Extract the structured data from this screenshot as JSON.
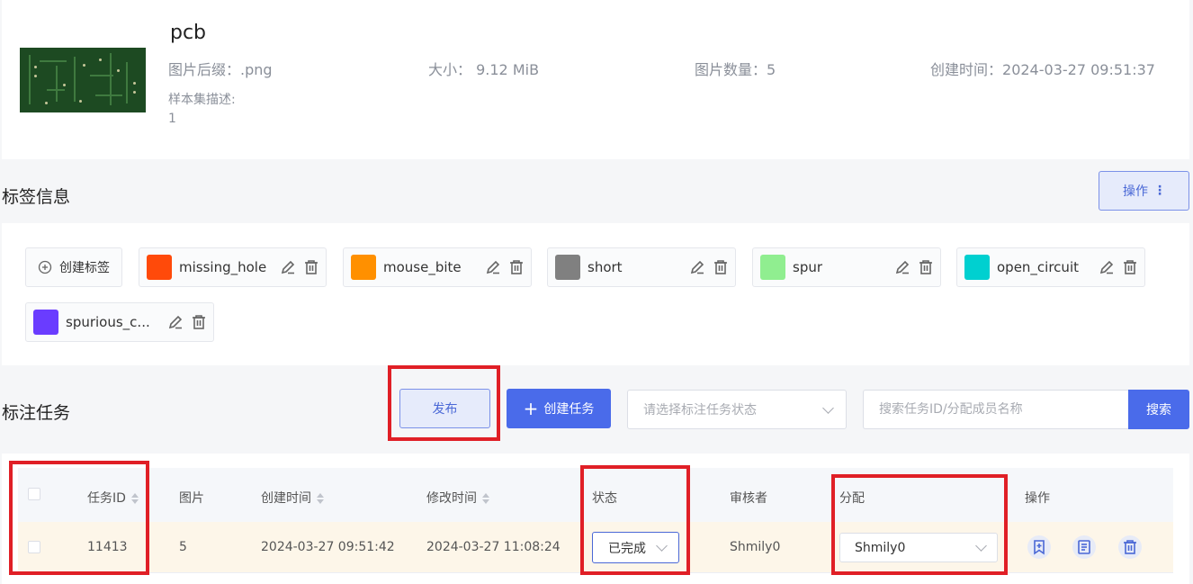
{
  "dataset": {
    "name": "pcb",
    "suffix_label": "图片后缀：",
    "suffix_value": ".png",
    "size_label": "大小：",
    "size_value": "9.12 MiB",
    "count_label": "图片数量：",
    "count_value": "5",
    "created_label": "创建时间：",
    "created_value": "2024-03-27 09:51:37",
    "desc_label": "样本集描述:",
    "desc_value": "1"
  },
  "labels_section": {
    "title": "标签信息",
    "ops_label": "操作",
    "create_label": "创建标签",
    "labels": [
      {
        "name": "missing_hole",
        "color": "#ff4a0a"
      },
      {
        "name": "mouse_bite",
        "color": "#ff9000"
      },
      {
        "name": "short",
        "color": "#808080"
      },
      {
        "name": "spur",
        "color": "#90ee90"
      },
      {
        "name": "open_circuit",
        "color": "#00d0d0"
      },
      {
        "name": "spurious_c...",
        "color": "#6a3cff"
      }
    ]
  },
  "tasks_section": {
    "title": "标注任务",
    "publish_label": "发布",
    "create_task_label": "创建任务",
    "status_placeholder": "请选择标注任务状态",
    "search_placeholder": "搜索任务ID/分配成员名称",
    "search_label": "搜索"
  },
  "table": {
    "headers": {
      "task_id": "任务ID",
      "images": "图片",
      "created": "创建时间",
      "modified": "修改时间",
      "status": "状态",
      "reviewer": "审核者",
      "assign": "分配",
      "actions": "操作"
    },
    "rows": [
      {
        "task_id": "11413",
        "images": "5",
        "created": "2024-03-27 09:51:42",
        "modified": "2024-03-27 11:08:24",
        "status": "已完成",
        "reviewer": "Shmily0",
        "assign": "Shmily0"
      }
    ]
  }
}
